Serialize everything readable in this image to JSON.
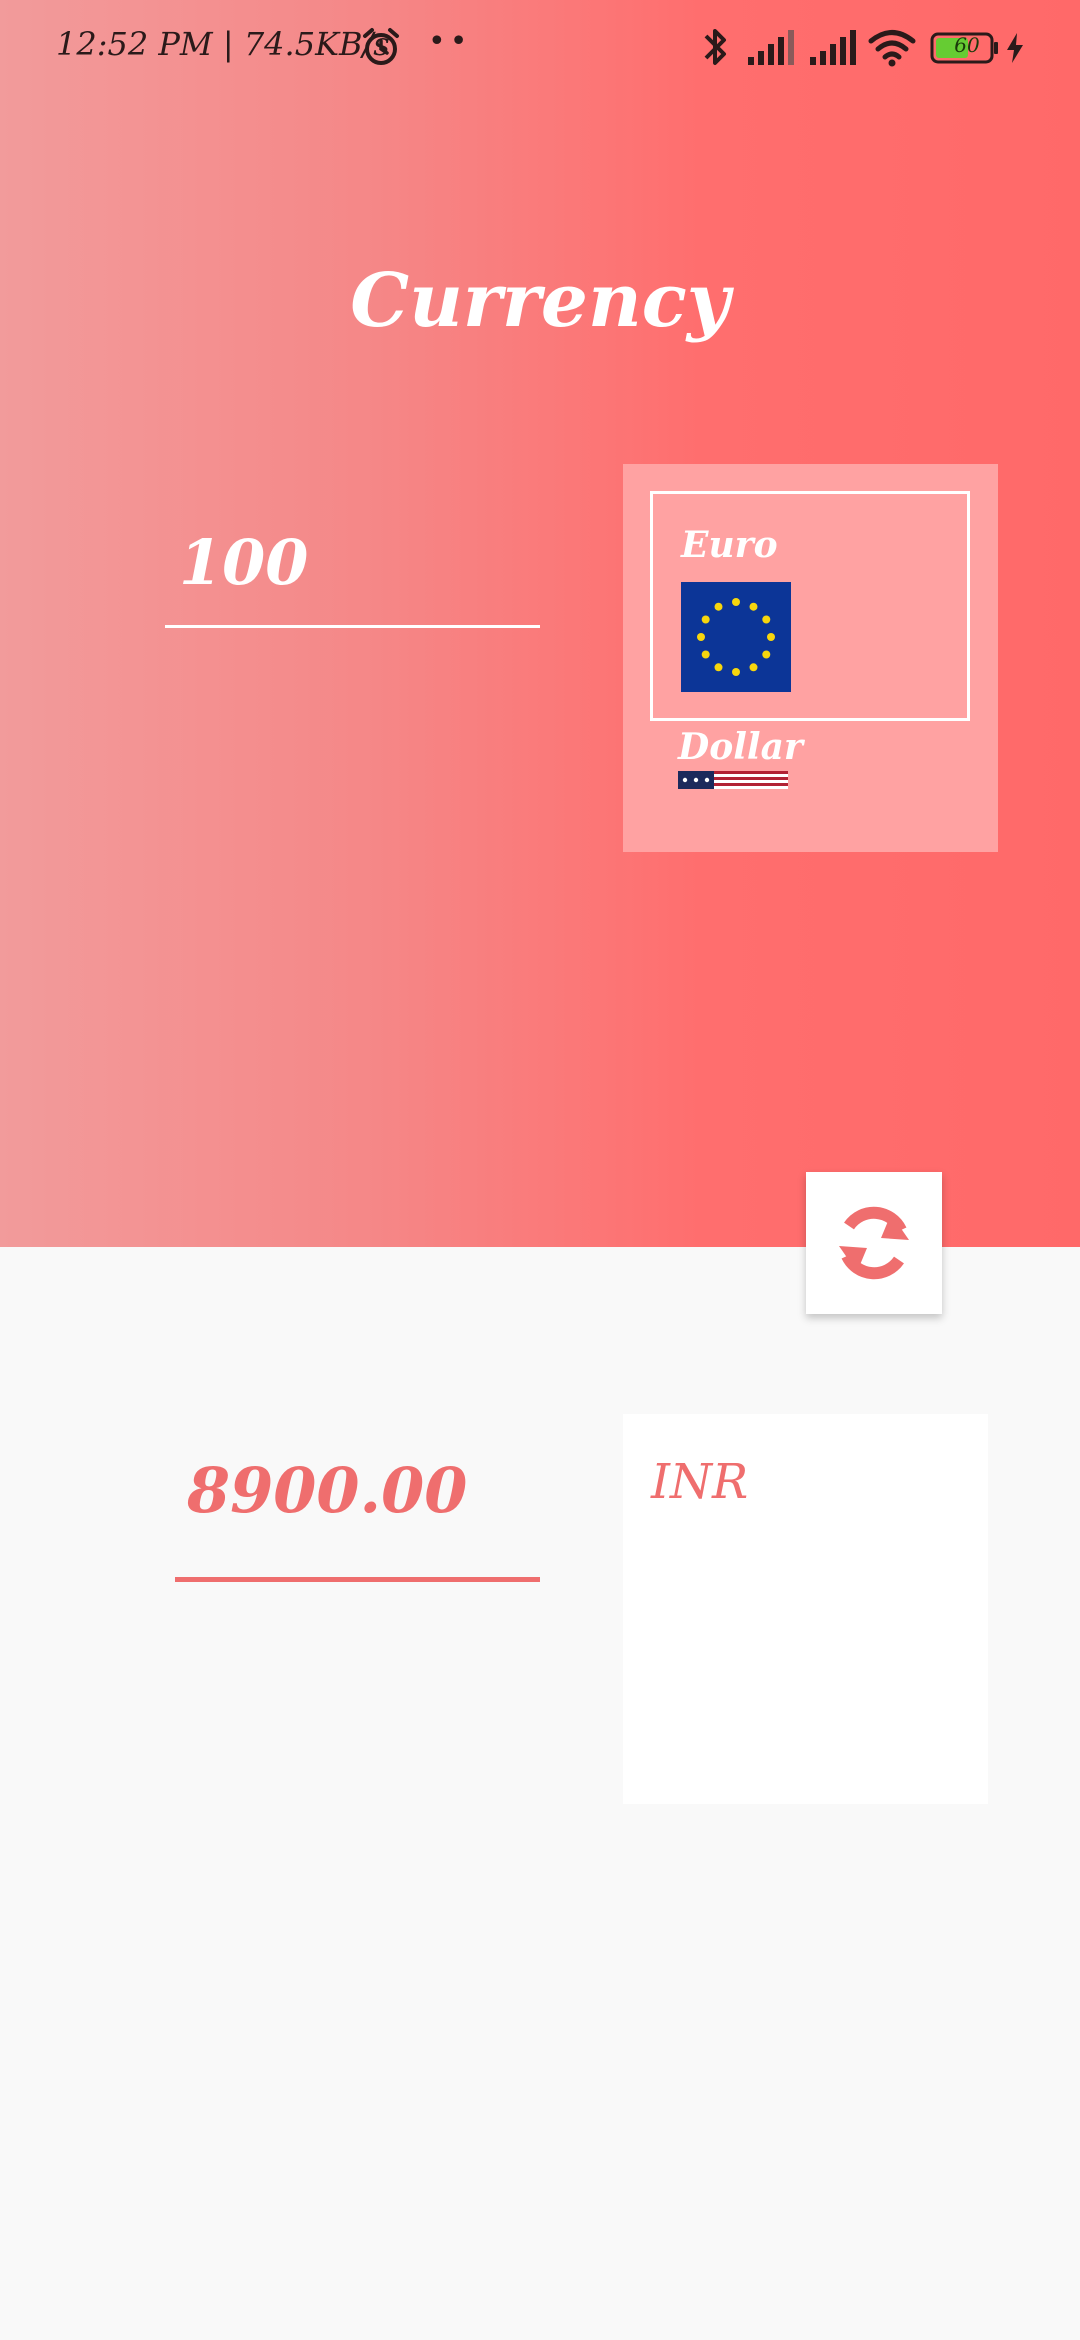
{
  "status_bar": {
    "time_speed": "12:52 PM | 74.5KB/s",
    "dots": "••",
    "battery_level": "60",
    "icons": [
      "alarm-icon",
      "bluetooth-icon",
      "signal-icon",
      "signal-icon",
      "wifi-icon",
      "battery-icon",
      "charging-icon"
    ]
  },
  "app": {
    "title": "Currency"
  },
  "converter": {
    "amount_value": "100",
    "from_currencies": [
      {
        "label": "Euro",
        "flag": "eu-flag-icon",
        "selected": true
      },
      {
        "label": "Dollar",
        "flag": "us-flag-icon",
        "selected": false
      }
    ],
    "swap_icon": "sync-icon",
    "result_value": "8900.00",
    "to_currency": "INR"
  },
  "colors": {
    "accent": "#ef6e6e",
    "gradient_start": "#f29b9b",
    "gradient_end": "#ff6969",
    "panel": "#ffa2a2"
  }
}
